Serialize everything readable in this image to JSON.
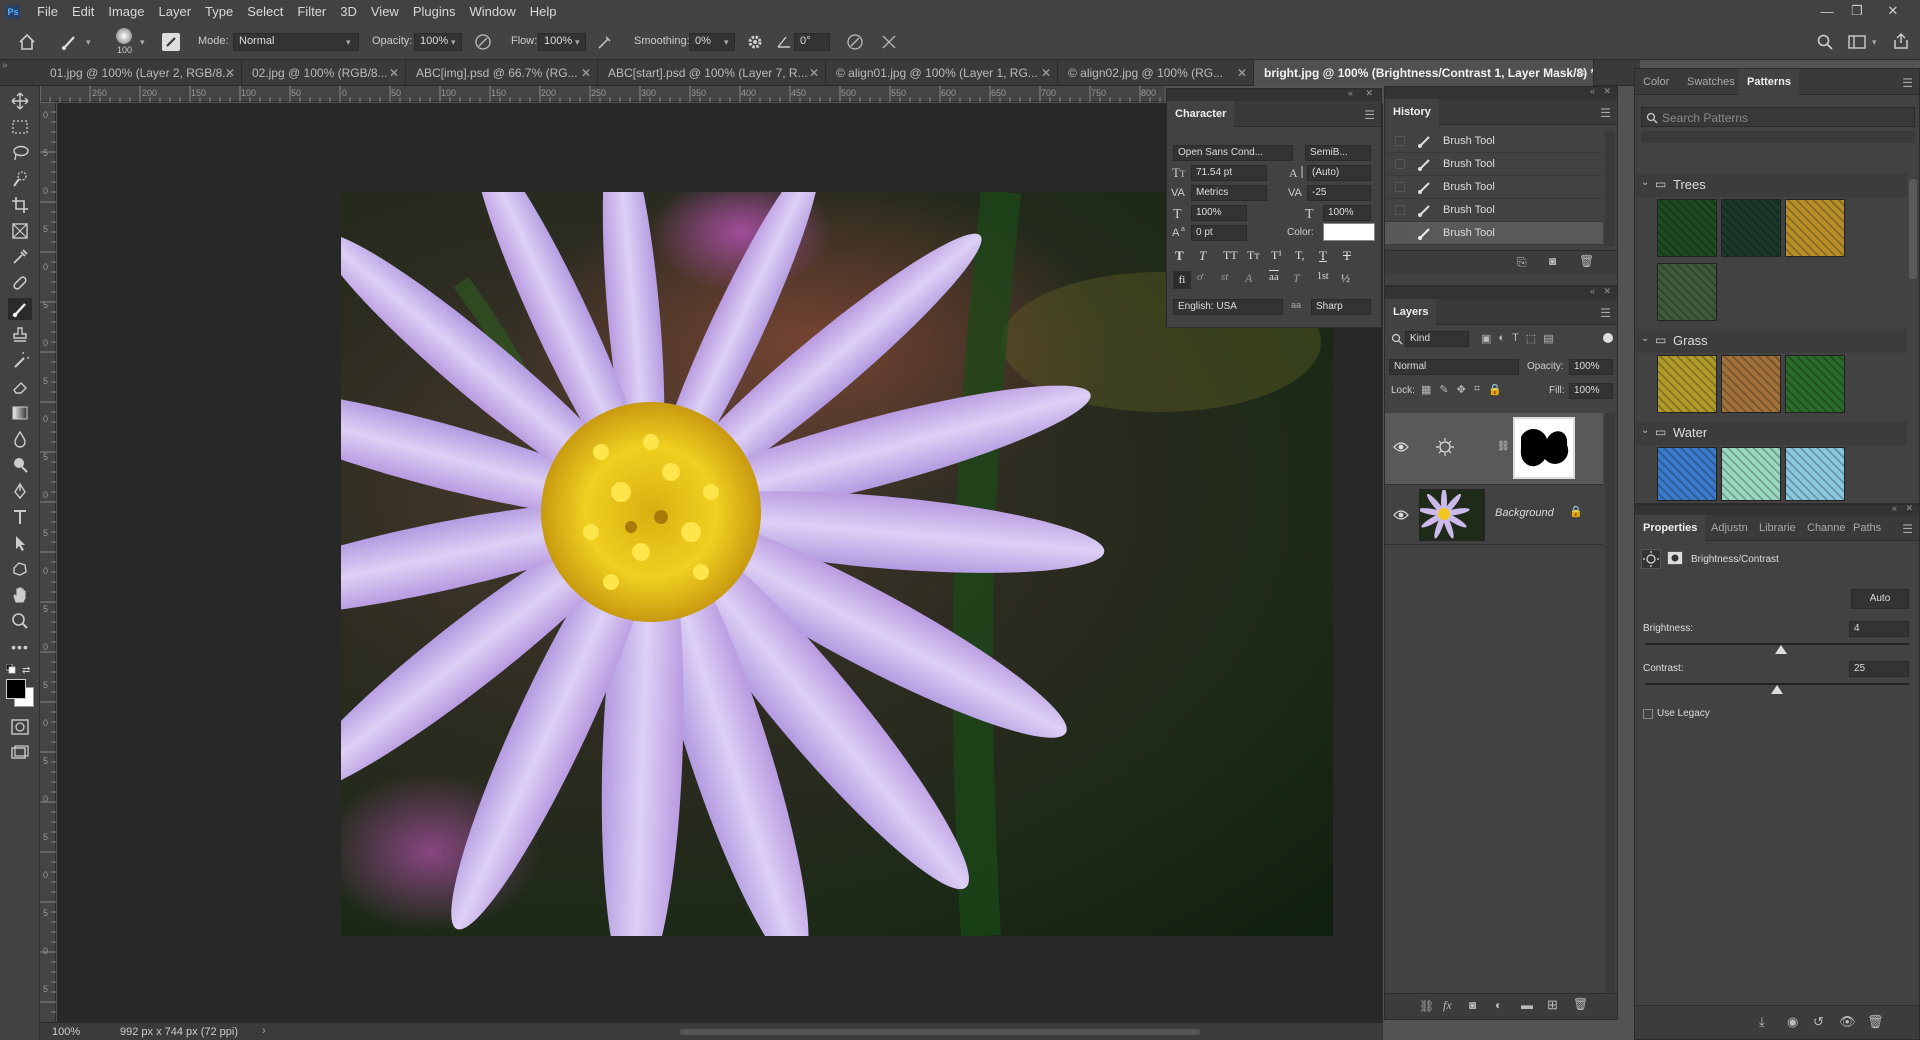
{
  "menubar": {
    "logo": "Ps",
    "items": [
      "File",
      "Edit",
      "Image",
      "Layer",
      "Type",
      "Select",
      "Filter",
      "3D",
      "View",
      "Plugins",
      "Window",
      "Help"
    ]
  },
  "options": {
    "brush_size": "100",
    "mode_label": "Mode:",
    "mode_value": "Normal",
    "opacity_label": "Opacity:",
    "opacity_value": "100%",
    "flow_label": "Flow:",
    "flow_value": "100%",
    "smoothing_label": "Smoothing:",
    "smoothing_value": "0%",
    "angle_value": "0°"
  },
  "tabs": [
    {
      "label": "01.jpg @ 100% (Layer 2, RGB/8..."
    },
    {
      "label": "02.jpg @ 100% (RGB/8..."
    },
    {
      "label": "ABC[img].psd @ 66.7% (RG..."
    },
    {
      "label": "ABC[start].psd @ 100% (Layer 7, R..."
    },
    {
      "label": "© align01.jpg @ 100% (Layer 1, RG..."
    },
    {
      "label": "© align02.jpg @ 100% (RG..."
    },
    {
      "label": "bright.jpg @ 100% (Brightness/Contrast 1, Layer Mask/8) *"
    }
  ],
  "ruler": {
    "top": [
      "250",
      "200",
      "150",
      "100",
      "50",
      "0",
      "50",
      "100",
      "150",
      "200",
      "250",
      "300",
      "350",
      "400",
      "450",
      "500",
      "550",
      "600",
      "650",
      "700",
      "750",
      "800"
    ],
    "left": [
      "0",
      "5",
      "0",
      "5",
      "0",
      "5",
      "0",
      "5",
      "0",
      "5",
      "0",
      "5",
      "0",
      "5",
      "0",
      "5",
      "0",
      "5",
      "0",
      "5",
      "0",
      "5",
      "0",
      "5"
    ]
  },
  "status": {
    "zoom": "100%",
    "doc_info": "992 px x 744 px (72 ppi)",
    "arrow": "›"
  },
  "character": {
    "title": "Character",
    "font_family": "Open Sans Cond...",
    "font_style": "SemiB...",
    "font_size": "71.54 pt",
    "leading": "(Auto)",
    "kerning": "Metrics",
    "tracking": "-25",
    "vscale": "100%",
    "hscale": "100%",
    "baseline": "0 pt",
    "color_label": "Color:",
    "color": "#ffffff",
    "type_buttons": [
      "T",
      "T",
      "TT",
      "Tт",
      "T¹",
      "T,",
      "T",
      "T"
    ],
    "opentype_buttons": [
      "fi",
      "ơ",
      "st",
      "A",
      "aa",
      "T",
      "1st",
      "½"
    ],
    "language": "English: USA",
    "antialias_icon": "aa",
    "antialias": "Sharp"
  },
  "history": {
    "title": "History",
    "items": [
      {
        "label": "Brush Tool"
      },
      {
        "label": "Brush Tool"
      },
      {
        "label": "Brush Tool"
      },
      {
        "label": "Brush Tool"
      },
      {
        "label": "Brush Tool"
      }
    ]
  },
  "layers": {
    "title": "Layers",
    "filter": "Kind",
    "blend": "Normal",
    "opacity_label": "Opacity:",
    "opacity": "100%",
    "lock_label": "Lock:",
    "fill_label": "Fill:",
    "fill": "100%",
    "items": [
      {
        "name": "",
        "type": "adjustment"
      },
      {
        "name": "Background",
        "type": "image"
      }
    ]
  },
  "patterns": {
    "tabs": [
      "Color",
      "Swatches",
      "Patterns"
    ],
    "search_placeholder": "Search Patterns",
    "groups": [
      {
        "name": "Trees",
        "colors": [
          "#1f4a22",
          "#1c3a2a",
          "#b8902a",
          "#3d5a3a"
        ]
      },
      {
        "name": "Grass",
        "colors": [
          "#b09a2a",
          "#a0703a",
          "#2a6a2a"
        ]
      },
      {
        "name": "Water",
        "colors": [
          "#3a7ac8",
          "#9ad8c0",
          "#8ac8e0"
        ]
      }
    ]
  },
  "properties": {
    "tabs": [
      "Properties",
      "Adjustn",
      "Librarie",
      "Channe",
      "Paths"
    ],
    "adjustment": "Brightness/Contrast",
    "auto_label": "Auto",
    "brightness_label": "Brightness:",
    "brightness": "4",
    "contrast_label": "Contrast:",
    "contrast": "25",
    "legacy_label": "Use Legacy",
    "brightness_range": [
      -150,
      150
    ],
    "contrast_range": [
      -50,
      100
    ]
  }
}
